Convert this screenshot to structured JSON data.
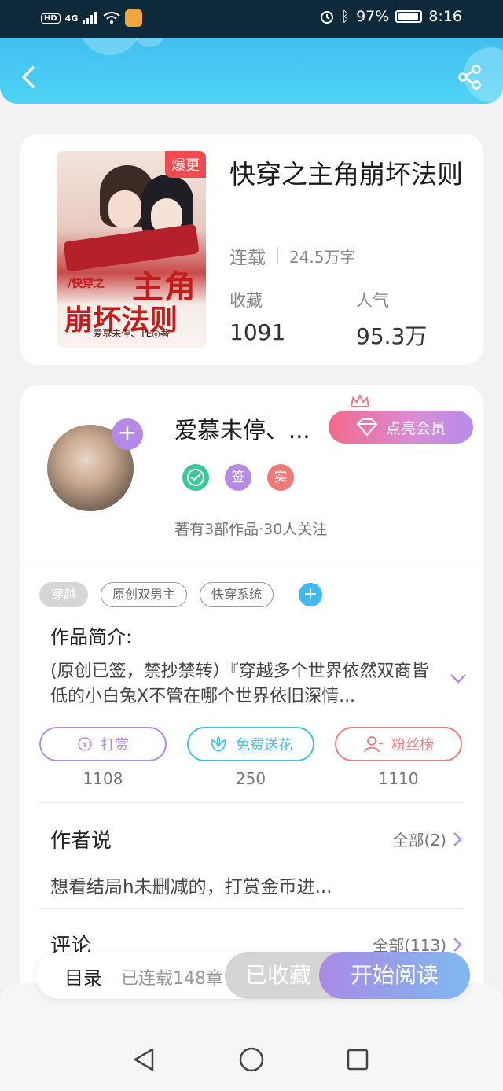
{
  "status_bar": {
    "hd": "HD",
    "network": "4G",
    "battery_percent": "97%",
    "battery_level": 0.97,
    "time": "8:16"
  },
  "header": {
    "back_icon": "chevron-left-icon",
    "share_icon": "share-icon"
  },
  "book": {
    "cover_tag": "爆更",
    "cover_title_small": "/快穿之",
    "cover_title_main": "主角",
    "cover_title_line2": "崩坏法则",
    "cover_author": "爱慕未停、TE◎著",
    "title": "快穿之主角崩坏法则",
    "status": "连载",
    "word_count": "24.5万字",
    "favorites_label": "收藏",
    "favorites_value": "1091",
    "popularity_label": "人气",
    "popularity_value": "95.3万"
  },
  "author": {
    "name": "爱慕未停、...",
    "vip_button": "点亮会员",
    "badge_sign": "签",
    "badge_real": "实",
    "info": "著有3部作品·30人关注",
    "colors": {
      "badge_green": "#3cc99a",
      "badge_purple": "#b58be6",
      "badge_red": "#f07a7a"
    }
  },
  "tags": [
    "穿越",
    "原创双男主",
    "快穿系统"
  ],
  "intro": {
    "title": "作品简介:",
    "text": "(原创已签，禁抄禁转）『穿越多个世界依然双商皆低的小白兔X不管在哪个世界依旧深情..."
  },
  "actions": [
    {
      "label": "打赏",
      "count": "1108",
      "color": "#b58be6"
    },
    {
      "label": "免费送花",
      "count": "250",
      "color": "#3fc2e8"
    },
    {
      "label": "粉丝榜",
      "count": "1110",
      "color": "#ef7c7c"
    }
  ],
  "author_says": {
    "title": "作者说",
    "link": "全部(2)",
    "text": "想看结局h未删减的，打赏金币进..."
  },
  "comments": {
    "title": "评论",
    "link": "全部(113)"
  },
  "bottom_bar": {
    "toc_label": "目录",
    "toc_count": "已连载148章",
    "favorite_button": "已收藏",
    "read_button": "开始阅读"
  }
}
